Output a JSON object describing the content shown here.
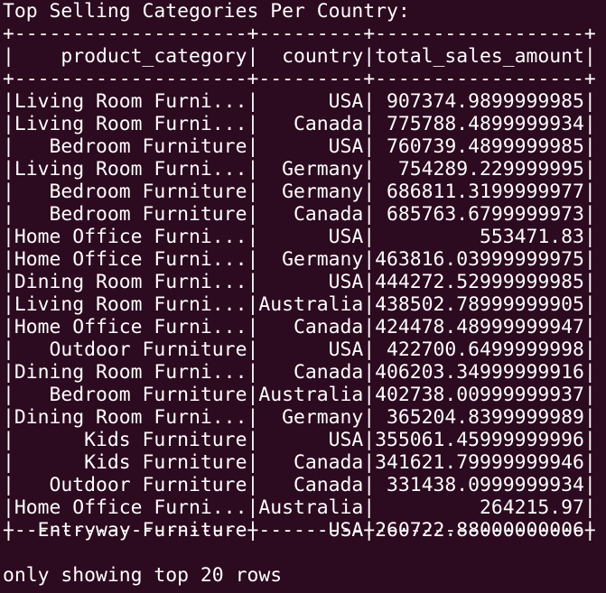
{
  "heading": "Top Selling Categories Per Country:",
  "table": {
    "border": "+--------------------+---------+------------------+",
    "headers": [
      "product_category",
      "country",
      "total_sales_amount"
    ],
    "rows": [
      [
        "Living Room Furni...",
        "USA",
        "907374.9899999985"
      ],
      [
        "Living Room Furni...",
        "Canada",
        "775788.4899999934"
      ],
      [
        "Bedroom Furniture",
        "USA",
        "760739.4899999985"
      ],
      [
        "Living Room Furni...",
        "Germany",
        "754289.229999995"
      ],
      [
        "Bedroom Furniture",
        "Germany",
        "686811.3199999977"
      ],
      [
        "Bedroom Furniture",
        "Canada",
        "685763.6799999973"
      ],
      [
        "Home Office Furni...",
        "USA",
        "553471.83"
      ],
      [
        "Home Office Furni...",
        "Germany",
        "463816.03999999975"
      ],
      [
        "Dining Room Furni...",
        "USA",
        "444272.52999999985"
      ],
      [
        "Living Room Furni...",
        "Australia",
        "438502.78999999905"
      ],
      [
        "Home Office Furni...",
        "Canada",
        "424478.48999999947"
      ],
      [
        "Outdoor Furniture",
        "USA",
        "422700.6499999998"
      ],
      [
        "Dining Room Furni...",
        "Canada",
        "406203.34999999916"
      ],
      [
        "Bedroom Furniture",
        "Australia",
        "402738.00999999937"
      ],
      [
        "Dining Room Furni...",
        "Germany",
        "365204.8399999989"
      ],
      [
        "Kids Furniture",
        "USA",
        "355061.45999999996"
      ],
      [
        "Kids Furniture",
        "Canada",
        "341621.79999999946"
      ],
      [
        "Outdoor Furniture",
        "Canada",
        "331438.0999999934"
      ],
      [
        "Home Office Furni...",
        "Australia",
        "264215.97"
      ],
      [
        "Entryway Furniture",
        "USA",
        "260722.88000000006"
      ]
    ]
  },
  "footer": "only showing top 20 rows",
  "colors": {
    "background": "#2c0a1f",
    "text": "#ffffff"
  }
}
